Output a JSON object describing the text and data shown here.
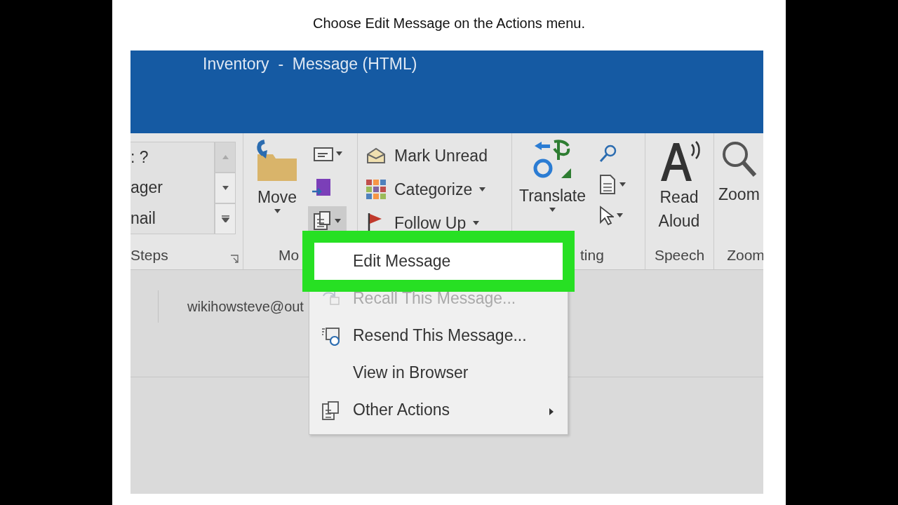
{
  "caption": "Choose Edit Message on the Actions menu.",
  "window": {
    "title": "Inventory  -  Message (HTML)"
  },
  "ribbon": {
    "groups": [
      {
        "kind": "gallery",
        "label": "Steps",
        "items": [
          ": ?",
          "ager",
          "nail"
        ]
      },
      {
        "kind": "move",
        "label": "Mo",
        "buttons": [
          {
            "label": "Move",
            "dropdown": true
          }
        ]
      },
      {
        "kind": "tags",
        "buttons": [
          {
            "label": "Mark Unread",
            "dropdown": false
          },
          {
            "label": "Categorize",
            "dropdown": true
          },
          {
            "label": "Follow Up",
            "dropdown": true
          }
        ]
      },
      {
        "kind": "editing",
        "label": "ting",
        "buttons": [
          {
            "label": "Translate",
            "dropdown": true
          }
        ]
      },
      {
        "kind": "speech",
        "label": "Speech",
        "buttons": [
          {
            "label": "Read Aloud",
            "dropdown": false
          }
        ]
      },
      {
        "kind": "zoom",
        "label": "Zoom",
        "buttons": [
          {
            "label": "Zoom",
            "dropdown": false
          }
        ]
      }
    ]
  },
  "message": {
    "sender": "wikihowsteve@out"
  },
  "menu": {
    "items": [
      {
        "label": "Edit Message",
        "selected": true,
        "disabled": false,
        "icon": false,
        "submenu": false
      },
      {
        "label": "Recall This Message...",
        "selected": false,
        "disabled": true,
        "icon": true,
        "submenu": false
      },
      {
        "label": "Resend This Message...",
        "selected": false,
        "disabled": false,
        "icon": true,
        "submenu": false
      },
      {
        "label": "View in Browser",
        "selected": false,
        "disabled": false,
        "icon": false,
        "submenu": false
      },
      {
        "label": "Other Actions",
        "selected": false,
        "disabled": false,
        "icon": true,
        "submenu": true
      }
    ]
  }
}
